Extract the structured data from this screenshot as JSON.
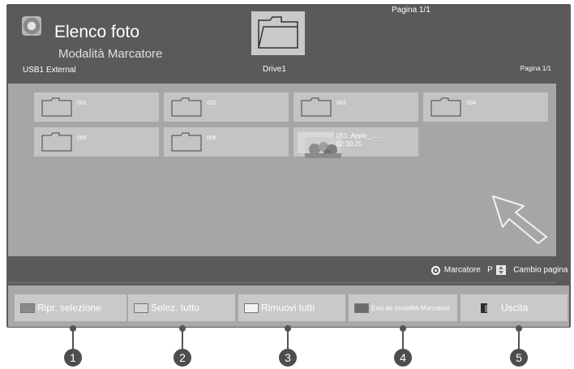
{
  "header": {
    "title": "Elenco foto",
    "subtitle": "Modalità Marcatore",
    "device": "USB1 External",
    "drive_label": "Drive1",
    "page_top": "Pagina 1/1",
    "page_right": "Pagina 1/1"
  },
  "files": [
    {
      "name": "001",
      "kind": "folder"
    },
    {
      "name": "002",
      "kind": "folder"
    },
    {
      "name": "003",
      "kind": "folder"
    },
    {
      "name": "004",
      "kind": "folder"
    },
    {
      "name": "005",
      "kind": "folder"
    },
    {
      "name": "006",
      "kind": "folder"
    },
    {
      "name": "051. Apple_ .....",
      "time": "02:30:25",
      "kind": "photo"
    }
  ],
  "legend": {
    "marker_label": "Marcatore",
    "page_key": "P",
    "page_label": "Cambio pagina"
  },
  "buttons": [
    {
      "label": "Ripr. selezione",
      "swatch": "#8a8a8a"
    },
    {
      "label": "Selez. tutto",
      "swatch": "#d4d4d4"
    },
    {
      "label": "Rimuovi tutti",
      "swatch": "#f2f2f2"
    },
    {
      "label": "Esci da modalità Marcatore",
      "swatch": "#6a6a6a"
    },
    {
      "label": "Uscita",
      "icon": "exit-door-icon"
    }
  ],
  "callouts": [
    "1",
    "2",
    "3",
    "4",
    "5"
  ]
}
